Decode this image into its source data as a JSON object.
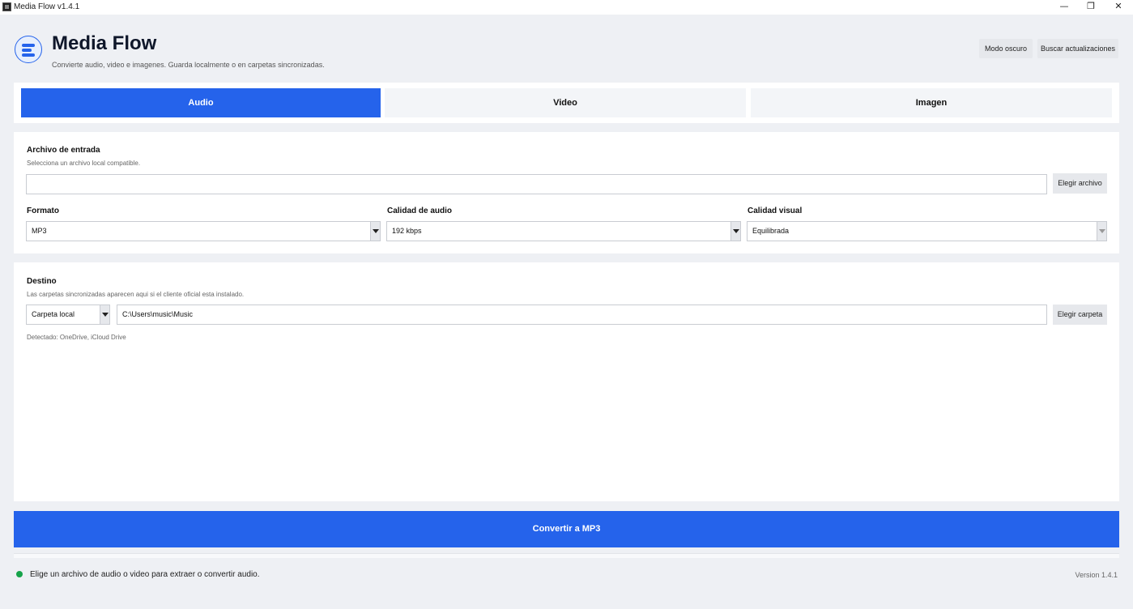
{
  "window": {
    "title": "Media Flow v1.4.1",
    "minimize_glyph": "—",
    "restore_glyph": "❐",
    "close_glyph": "✕"
  },
  "header": {
    "app_name": "Media Flow",
    "subtitle": "Convierte audio, video e imagenes. Guarda localmente o en carpetas sincronizadas.",
    "dark_mode_label": "Modo oscuro",
    "check_updates_label": "Buscar actualizaciones",
    "logo_icon": "menu-lines-icon",
    "accent_color": "#2563eb"
  },
  "tabs": [
    {
      "label": "Audio",
      "active": true
    },
    {
      "label": "Video",
      "active": false
    },
    {
      "label": "Imagen",
      "active": false
    }
  ],
  "input_section": {
    "title": "Archivo de entrada",
    "hint": "Selecciona un archivo local compatible.",
    "file_value": "",
    "choose_file_label": "Elegir archivo",
    "format_label": "Formato",
    "format_value": "MP3",
    "audio_quality_label": "Calidad de audio",
    "audio_quality_value": "192 kbps",
    "visual_quality_label": "Calidad visual",
    "visual_quality_value": "Equilibrada"
  },
  "destination_section": {
    "title": "Destino",
    "hint": "Las carpetas sincronizadas aparecen aqui si el cliente oficial esta instalado.",
    "location_type_value": "Carpeta local",
    "path_value": "C:\\Users\\music\\Music",
    "choose_folder_label": "Elegir carpeta",
    "detected_text": "Detectado: OneDrive, iCloud Drive"
  },
  "convert_button_label": "Convertir a MP3",
  "status": {
    "message": "Elige un archivo de audio o video para extraer o convertir audio.",
    "dot_color": "#16a34a",
    "version": "Version 1.4.1"
  }
}
